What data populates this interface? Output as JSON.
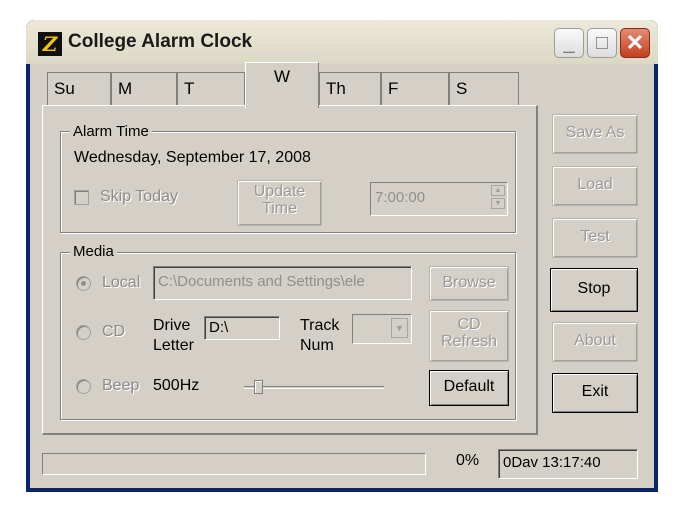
{
  "window": {
    "title": "College Alarm Clock",
    "app_icon_glyph": "Z"
  },
  "title_buttons": {
    "minimize": "_",
    "maximize": "□",
    "close": "✕"
  },
  "tabs": [
    {
      "label": "Su"
    },
    {
      "label": "M"
    },
    {
      "label": "T"
    },
    {
      "label": "W"
    },
    {
      "label": "Th"
    },
    {
      "label": "F"
    },
    {
      "label": "S"
    }
  ],
  "active_tab": "W",
  "alarm_time": {
    "group_label": "Alarm Time",
    "date": "Wednesday, September 17, 2008",
    "skip_today": "Skip Today",
    "skip_today_checked": false,
    "update_button": "Update Time",
    "time_value": "7:00:00"
  },
  "media": {
    "group_label": "Media",
    "local_label": "Local",
    "local_path": "C:\\Documents and Settings\\ele",
    "browse_button": "Browse",
    "cd_label": "CD",
    "drive_letter_label": "Drive Letter",
    "drive_value": "D:\\",
    "track_num_label": "Track Num",
    "track_value": "",
    "cd_refresh_button": "CD Refresh",
    "beep_label": "Beep",
    "beep_freq": "500Hz",
    "default_button": "Default",
    "selected_source": "Local",
    "beep_level": 0.1
  },
  "side_buttons": {
    "save_as": "Save As",
    "load": "Load",
    "test": "Test",
    "stop": "Stop",
    "about": "About",
    "exit": "Exit"
  },
  "status": {
    "progress_percent": 0,
    "progress_text": "0%",
    "time_left": "0Dav 13:17:40"
  },
  "colors": {
    "face": "#d4d0c8",
    "titlebar": "#ece9d8",
    "close": "#d2552e",
    "disabled_text": "#8b8b8b"
  }
}
